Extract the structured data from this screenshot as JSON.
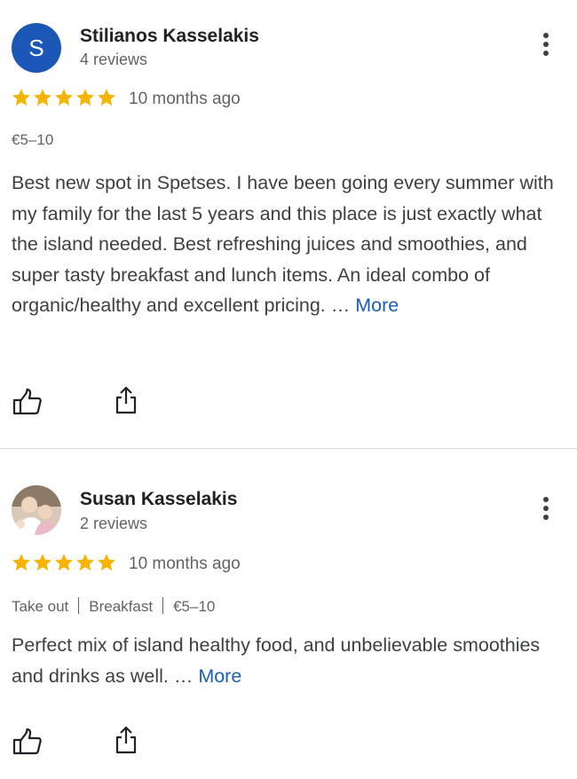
{
  "reviews": [
    {
      "avatar_letter": "S",
      "avatar_color": "#1a57b7",
      "name": "Stilianos Kasselakis",
      "review_count": "4 reviews",
      "rating": 5,
      "time_ago": "10 months ago",
      "tags": [
        "€5–10"
      ],
      "text": "Best new spot in Spetses. I have been going every summer with my family for the last 5 years and this place is just exactly what the island needed. Best refreshing juices and smoothies, and super tasty breakfast and lunch items. An ideal combo of organic/healthy and excellent pricing. … ",
      "more_label": "More"
    },
    {
      "avatar_type": "photo",
      "name": "Susan Kasselakis",
      "review_count": "2 reviews",
      "rating": 5,
      "time_ago": "10 months ago",
      "tags": [
        "Take out",
        "Breakfast",
        "€5–10"
      ],
      "text": "Perfect mix of island healthy food, and unbelievable smoothies and drinks as well. … ",
      "more_label": "More"
    }
  ],
  "colors": {
    "star": "#f4b400",
    "link": "#1a5fb4",
    "divider": "#dadce0"
  },
  "icons": [
    "more-vert-icon",
    "star-icon",
    "thumbs-up-icon",
    "share-icon"
  ]
}
